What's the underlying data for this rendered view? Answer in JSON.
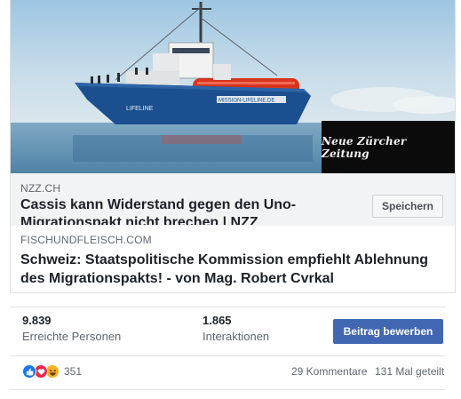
{
  "link_preview": {
    "image_logo_text": "Neue Zürcher Zeitung",
    "ship_hull_text": "LIFELINE",
    "ship_banner_text": "MISSION-LIFELINE.DE",
    "domain": "NZZ.CH",
    "headline": "Cassis kann Widerstand gegen den Uno-Migrationspakt nicht brechen | NZZ",
    "save_label": "Speichern"
  },
  "shared_post": {
    "domain": "FISCHUNDFLEISCH.COM",
    "title": "Schweiz: Staatspolitische Kommission empfiehlt Ablehnung des Migrationspakts! - von Mag. Robert Cvrkal"
  },
  "insights": {
    "reach_value": "9.839",
    "reach_label": "Erreichte Personen",
    "interactions_value": "1.865",
    "interactions_label": "Interaktionen",
    "boost_label": "Beitrag bewerben"
  },
  "engagement": {
    "reaction_icons": [
      "like-icon",
      "love-icon",
      "haha-icon"
    ],
    "reaction_count": "351",
    "comments": "29 Kommentare",
    "shares": "131 Mal geteilt"
  },
  "colors": {
    "accent": "#4267b2",
    "like": "#1877f2",
    "love": "#f0284a",
    "haha": "#f7b125",
    "ship_hull": "#1b4f8f",
    "ship_red": "#d9341f"
  }
}
